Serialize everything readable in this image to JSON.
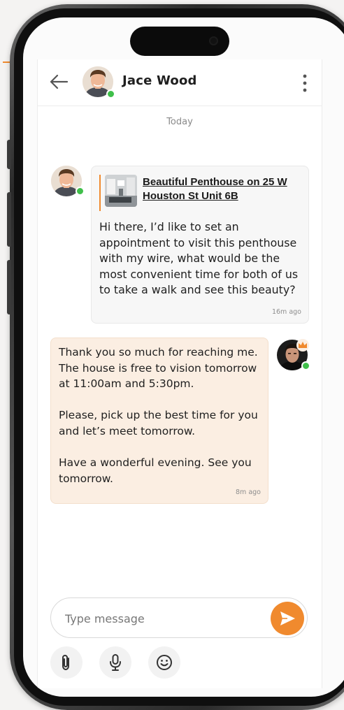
{
  "header": {
    "contact_name": "Jace Wood",
    "contact_status": "online"
  },
  "conversation": {
    "date_separator": "Today",
    "messages": [
      {
        "direction": "incoming",
        "listing_title": "Beautiful Penthouse on 25 W Houston St Unit 6B",
        "text": "Hi there, I’d like to set an appointment to visit this penthouse with my wire, what would be the most convenient time for both of us to take a walk and see this beauty?",
        "time": "16m ago"
      },
      {
        "direction": "outgoing",
        "text": "Thank you so much for reaching me. The house is free to vision tomorrow at 11:00am and 5:30pm.\n\nPlease, pick up the best time for you and let’s meet tomorrow.\n\nHave a wonderful evening. See you tomorrow.",
        "time": "8m ago"
      }
    ]
  },
  "composer": {
    "placeholder": "Type message"
  },
  "icons": {
    "back": "arrow-left-icon",
    "menu": "more-vertical-icon",
    "send": "send-icon",
    "attach": "paperclip-icon",
    "voice": "microphone-icon",
    "emoji": "smiley-icon",
    "badge": "crown-icon"
  },
  "colors": {
    "accent": "#f08a2e",
    "online": "#3fbf4a",
    "outgoing_bubble": "#fbeee2",
    "incoming_bubble": "#f7f7f7"
  }
}
